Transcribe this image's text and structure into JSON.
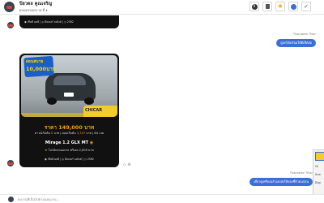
{
  "header": {
    "name": "ปิยวดล คูณเจริญ",
    "status": "ผ่อนครบทุกบาท ที่ ▾",
    "buttons": [
      {
        "id": "info",
        "icon": "info-icon",
        "glyph": "i"
      },
      {
        "id": "delete",
        "icon": "trash-icon"
      },
      {
        "id": "star",
        "icon": "star-icon",
        "glyph": "★"
      },
      {
        "id": "settings",
        "icon": "settings-icon"
      },
      {
        "id": "done",
        "icon": "check-icon",
        "glyph": "✓"
      }
    ]
  },
  "messages": {
    "stub_meta": "◉ เช็คดี ผลดี  |  ◎ ดีลเลอร์ ลงลิงค์  |  ◷ 2562",
    "out1": {
      "sender": "Thanawan Thiar",
      "text": "ดูลดได้พร้อมให้ดีเช็คย่อ"
    },
    "car": {
      "badge_line1": "ผ่อนสบาย",
      "badge_line2": "10,000บาท",
      "watermark": "CHICAR",
      "price": "ราคา 149,000 บาท",
      "terms_before": "ดาวน์เริ่มต้น ",
      "terms_highlight": "0",
      "terms_mid": " บาท | ผ่อนเริ่มต้น ",
      "terms_highlight2": "3,747",
      "terms_after": " บาท | 84 งวด",
      "model": "Mirage 1.2 GLX MT",
      "model_check": "◉",
      "promo_star": "★",
      "promo": " โปรนัดรถออกรถ ฟรีเลย 2,000 บาท",
      "meta": "◉ เช็คดี ผลดี  |  ◎ ดีลเลอร์ ลงลิงค์  |  ◷ 2562"
    },
    "card_actions": "◇ ⊕",
    "out2": {
      "sender": "Thanawan Thiar",
      "text": "เดี๋ยวดูเครื่องแล้วเลยส่งให้ลองชี้ตัวตนก่อน"
    }
  },
  "popup": {
    "lines": [
      "Ch",
      "Scre",
      "Disp"
    ]
  },
  "composer": {
    "placeholder": "ผลงานดีเป็นไปตามแผนงาน..."
  },
  "colors": {
    "accent": "#3b6fd6",
    "card_bg": "#111111",
    "price": "#f39c12"
  }
}
